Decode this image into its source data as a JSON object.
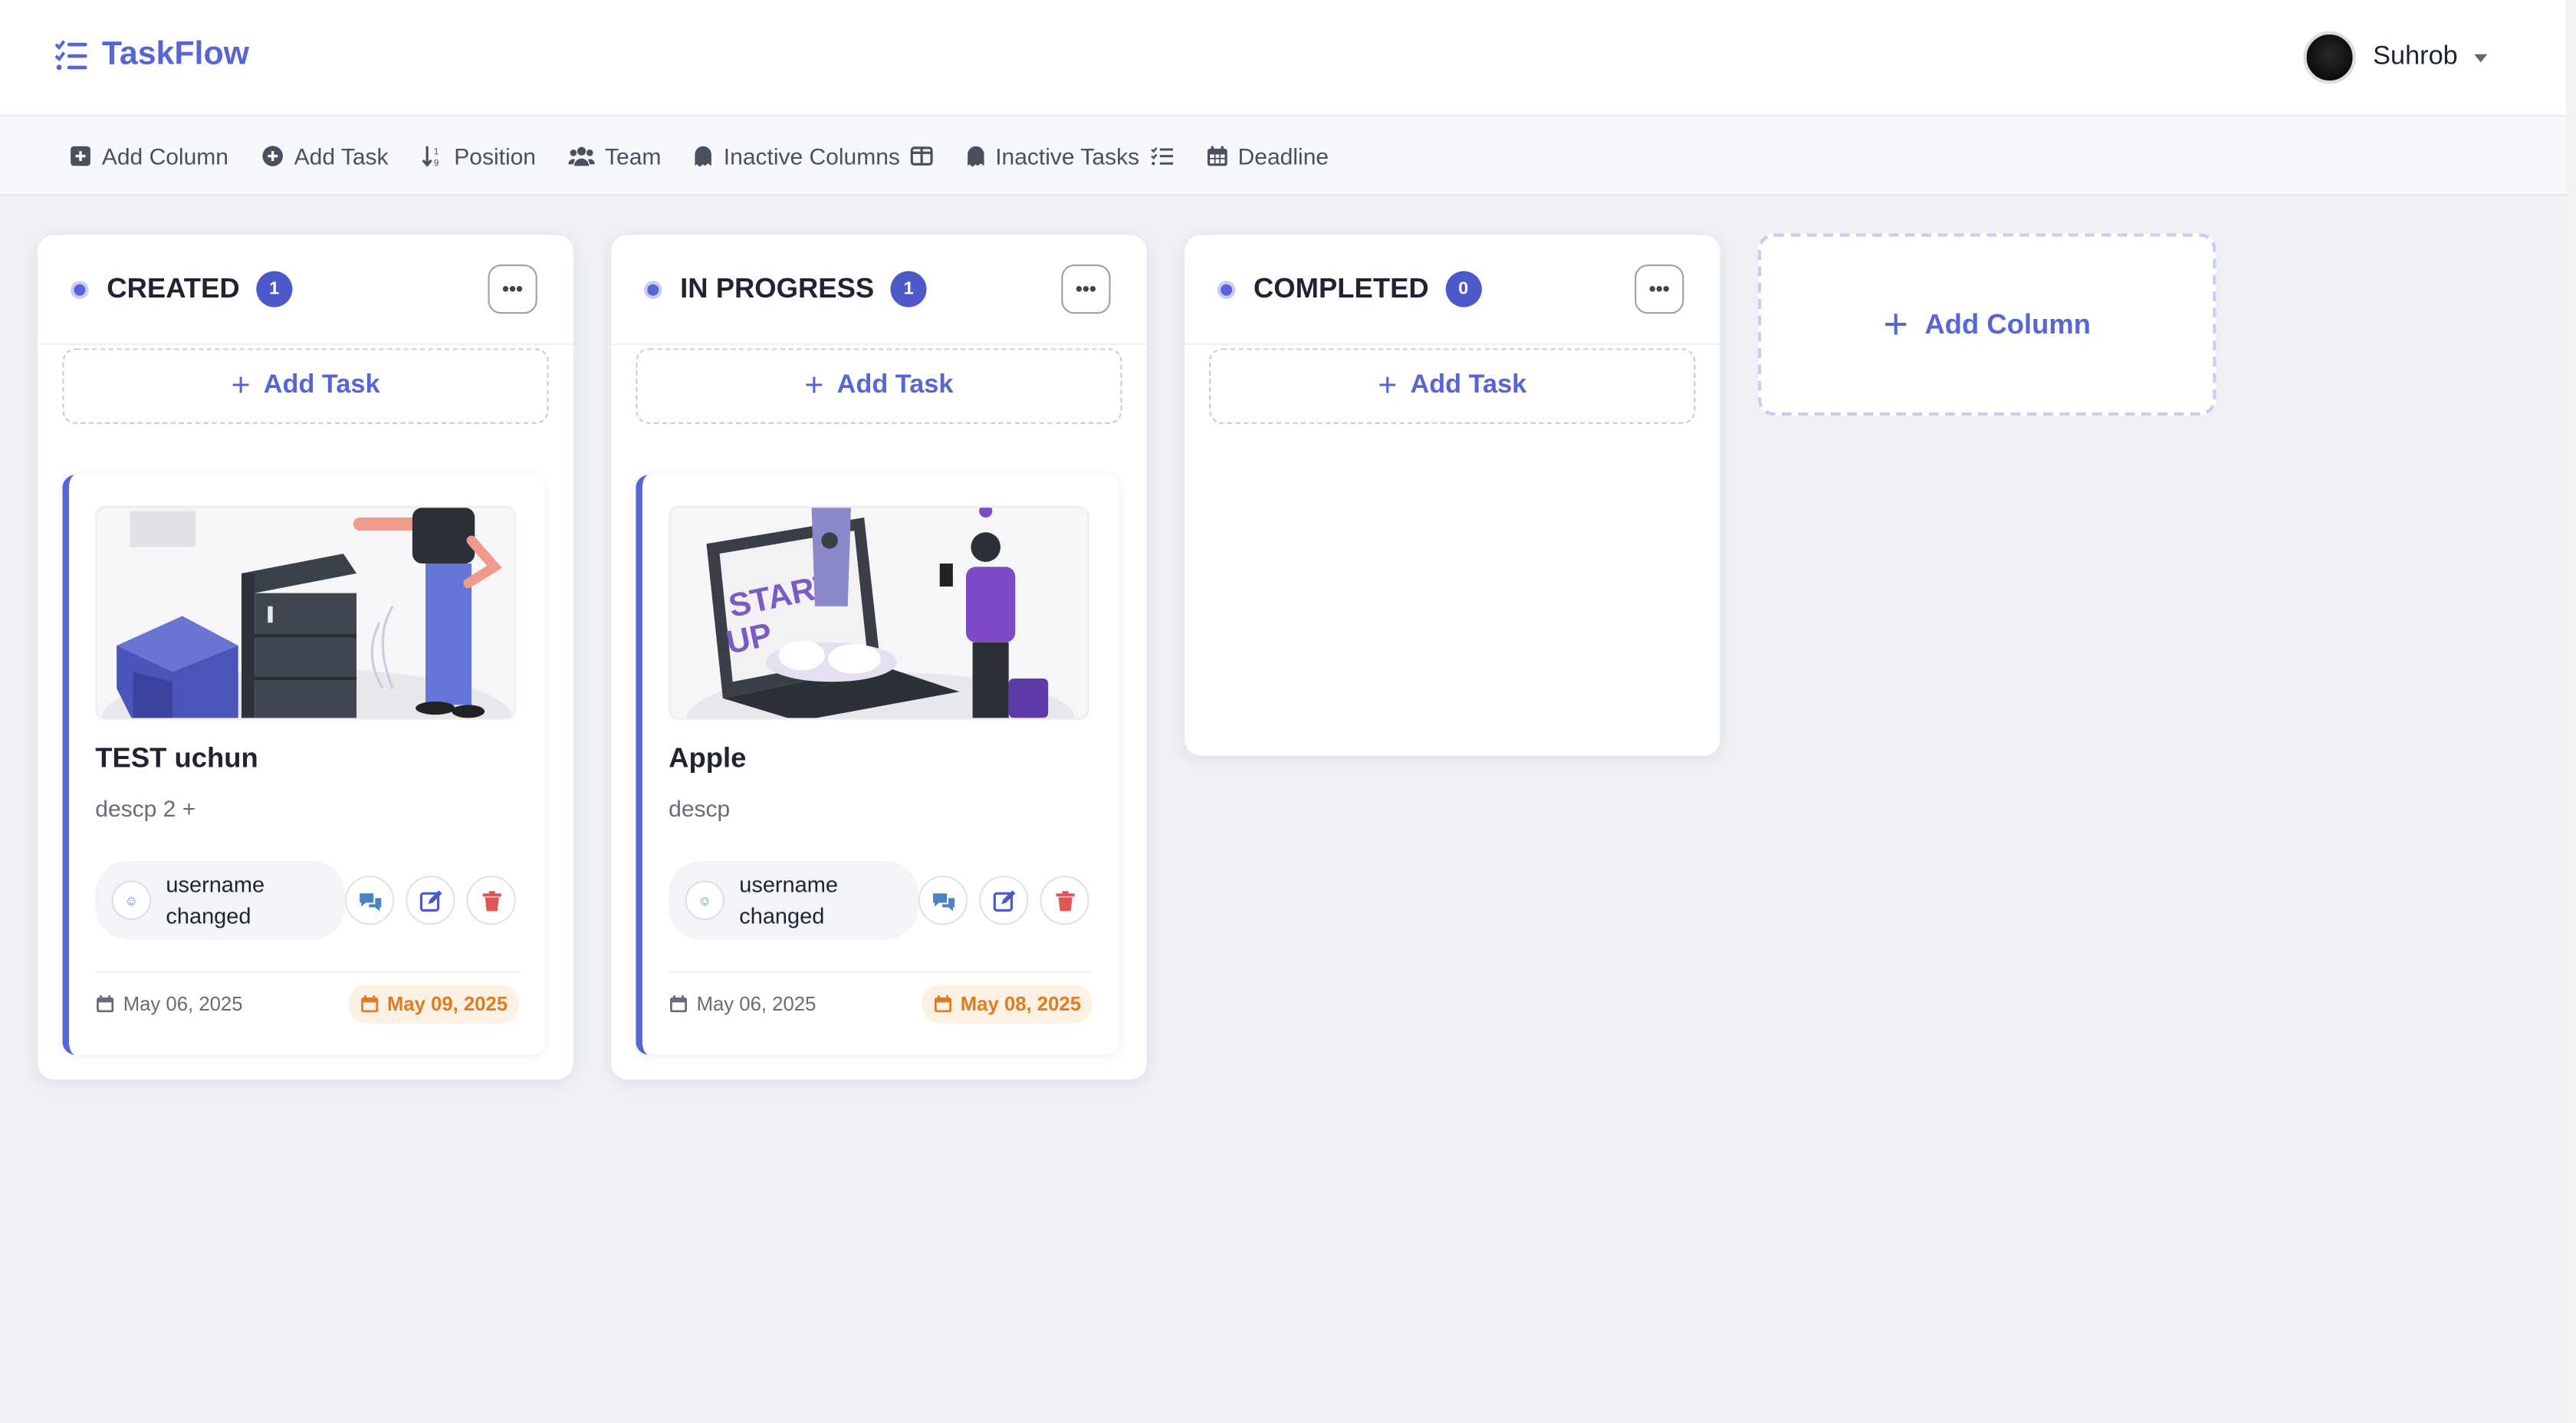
{
  "app": {
    "title": "TaskFlow"
  },
  "user": {
    "name": "Suhrob"
  },
  "toolbar": {
    "add_column": "Add Column",
    "add_task": "Add Task",
    "position": "Position",
    "team": "Team",
    "inactive_columns": "Inactive Columns",
    "inactive_tasks": "Inactive Tasks",
    "deadline": "Deadline"
  },
  "columns": [
    {
      "title": "CREATED",
      "count": "1",
      "add_task_label": "Add Task",
      "cards": [
        {
          "title": "TEST uchun",
          "description": "descp 2 +",
          "assignee": "username changed",
          "created": "May 06, 2025",
          "deadline": "May 09, 2025"
        }
      ]
    },
    {
      "title": "IN PROGRESS",
      "count": "1",
      "add_task_label": "Add Task",
      "cards": [
        {
          "title": "Apple",
          "description": "descp",
          "assignee": "username changed",
          "created": "May 06, 2025",
          "deadline": "May 08, 2025"
        }
      ]
    },
    {
      "title": "COMPLETED",
      "count": "0",
      "add_task_label": "Add Task",
      "cards": []
    }
  ],
  "add_column_card": {
    "label": "Add Column"
  },
  "colors": {
    "accent": "#5865d6",
    "deadline": "#e07b21",
    "delete": "#e05555",
    "edit": "#4d59c9",
    "comment": "#4b83c4"
  }
}
